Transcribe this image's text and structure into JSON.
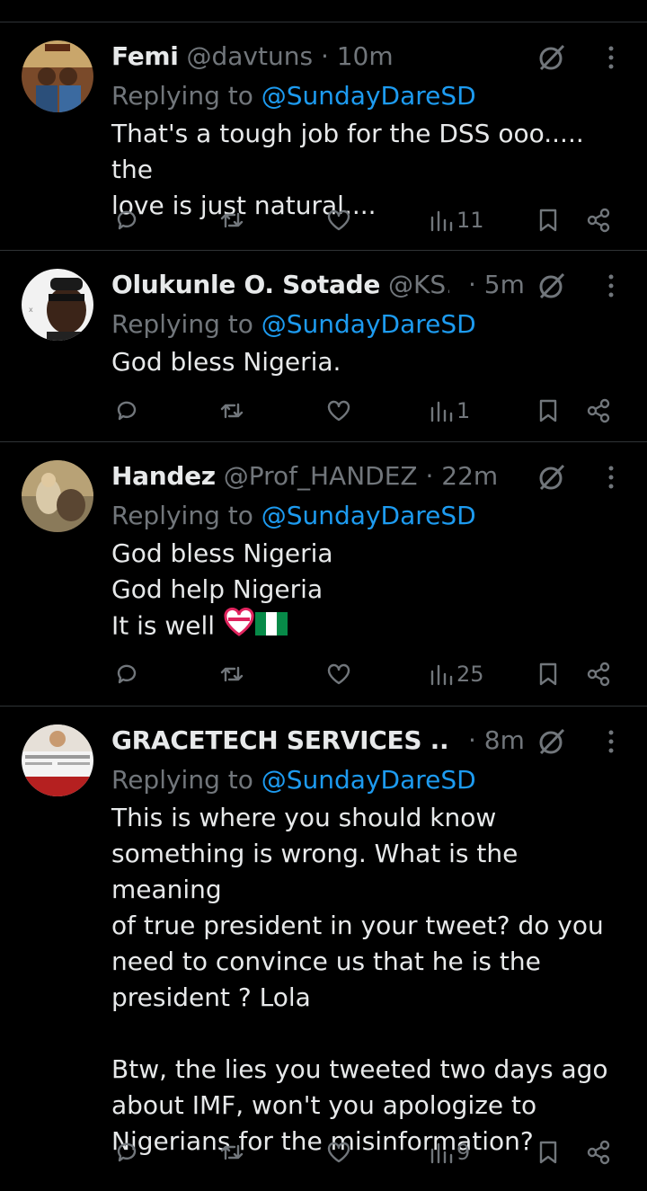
{
  "colors": {
    "background": "#000000",
    "text": "#e7e9ea",
    "muted": "#71767b",
    "link": "#1d9bf0",
    "divider": "#2f3336"
  },
  "tweets": [
    {
      "name": "Femi",
      "handle": "@davtuns",
      "time": "· 10m",
      "replying_label": "Replying to",
      "replying_handle": "@SundayDareSD",
      "lines": [
        "That's a tough job for the DSS ooo..... the",
        "love is just natural...."
      ],
      "views": "11",
      "icons": [
        "reply-icon",
        "retweet-icon",
        "like-icon",
        "views-icon",
        "bookmark-icon",
        "share-icon"
      ]
    },
    {
      "name": "Olukunle O. Sotade",
      "handle": "@KS...",
      "time": "· 5m",
      "replying_label": "Replying to",
      "replying_handle": "@SundayDareSD",
      "lines": [
        "God bless Nigeria."
      ],
      "views": "1"
    },
    {
      "name": "Handez",
      "handle": "@Prof_HANDEZ",
      "time": "· 22m",
      "replying_label": "Replying to",
      "replying_handle": "@SundayDareSD",
      "lines": [
        "God bless Nigeria",
        "God help Nigeria",
        "It is well"
      ],
      "views": "25"
    },
    {
      "name": "GRACETECH SERVICES ...",
      "handle": "",
      "time": "· 8m",
      "replying_label": "Replying to",
      "replying_handle": "@SundayDareSD",
      "lines": [
        "This is where you should know",
        "something is wrong. What is the meaning",
        "of true president in your tweet? do you",
        "need to convince us that he is the",
        "president ? Lola",
        "",
        "Btw, the lies you tweeted two days ago",
        "about IMF, won't you apologize to",
        "Nigerians for the misinformation?"
      ],
      "views": "9"
    }
  ]
}
